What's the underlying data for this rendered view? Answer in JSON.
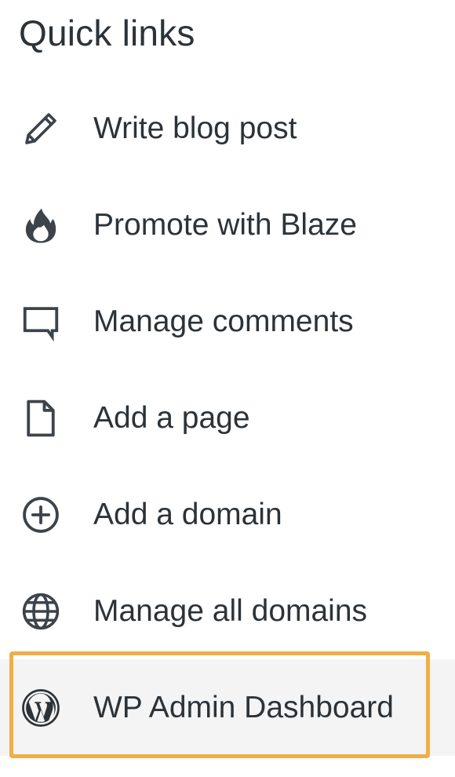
{
  "section": {
    "title": "Quick links"
  },
  "links": [
    {
      "label": "Write blog post",
      "icon": "pencil-icon"
    },
    {
      "label": "Promote with Blaze",
      "icon": "flame-icon"
    },
    {
      "label": "Manage comments",
      "icon": "comment-icon"
    },
    {
      "label": "Add a page",
      "icon": "page-icon"
    },
    {
      "label": "Add a domain",
      "icon": "plus-circle-icon"
    },
    {
      "label": "Manage all domains",
      "icon": "globe-icon"
    },
    {
      "label": "WP Admin Dashboard",
      "icon": "wordpress-icon"
    }
  ],
  "colors": {
    "text": "#2c3338",
    "highlight_border": "#f0ae45",
    "highlight_background": "#f4f4f5"
  }
}
